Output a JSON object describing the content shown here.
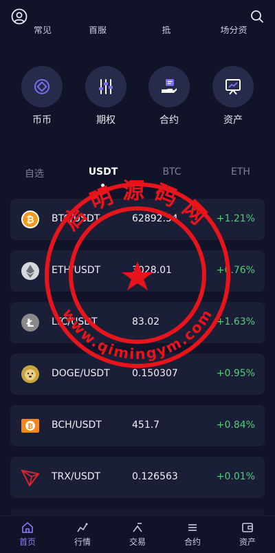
{
  "cutoff_row": [
    "常见",
    "首服",
    "抵",
    "场分资"
  ],
  "quick_links": [
    {
      "label": "币币",
      "icon": "coin-swap-icon"
    },
    {
      "label": "期权",
      "icon": "sliders-icon"
    },
    {
      "label": "合约",
      "icon": "contract-hand-icon"
    },
    {
      "label": "资产",
      "icon": "chart-board-icon"
    }
  ],
  "market_tabs": [
    "自选",
    "USDT",
    "BTC",
    "ETH"
  ],
  "market_rows": [
    {
      "pair": "BTC/USDT",
      "price": "62892.54",
      "change": "+1.21%",
      "icon": "btc-icon",
      "color": "#f39a1e"
    },
    {
      "pair": "ETH/USDT",
      "price": "3028.01",
      "change": "+0.76%",
      "icon": "eth-icon",
      "color": "#6d6f78"
    },
    {
      "pair": "LTC/USDT",
      "price": "83.02",
      "change": "+1.63%",
      "icon": "ltc-icon",
      "color": "#8a8a8a"
    },
    {
      "pair": "DOGE/USDT",
      "price": "0.150307",
      "change": "+0.95%",
      "icon": "doge-icon",
      "color": "#c8a43c"
    },
    {
      "pair": "BCH/USDT",
      "price": "451.7",
      "change": "+0.84%",
      "icon": "bch-icon",
      "color": "#f5851f"
    },
    {
      "pair": "TRX/USDT",
      "price": "0.126563",
      "change": "+0.01%",
      "icon": "trx-icon",
      "color": "#d8262f"
    }
  ],
  "bottom_nav": [
    {
      "label": "首页",
      "icon": "home-icon",
      "active": true
    },
    {
      "label": "行情",
      "icon": "market-chart-icon",
      "active": false
    },
    {
      "label": "交易",
      "icon": "trade-icon",
      "active": false
    },
    {
      "label": "合约",
      "icon": "contract-icon",
      "active": false
    },
    {
      "label": "资产",
      "icon": "wallet-icon",
      "active": false
    }
  ],
  "watermark": {
    "text_top": "启明源码网",
    "text_bottom": "www.qimingym.com",
    "color": "#e8141b"
  },
  "colors": {
    "background": "#111428",
    "card": "#1a1e36",
    "up": "#4fcf7a",
    "accent": "#8b7cf6"
  }
}
